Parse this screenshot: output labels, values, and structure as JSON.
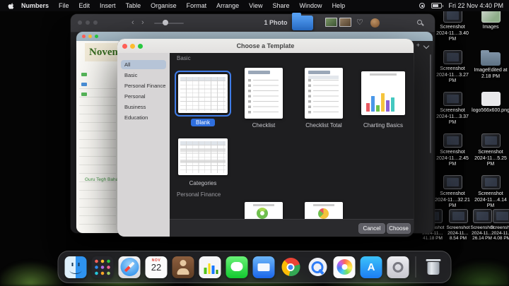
{
  "colors": {
    "accent_blue": "#2f6fde",
    "selection_sidebar": "#b6c4d7"
  },
  "menu_bar": {
    "app_name": "Numbers",
    "menus": [
      "File",
      "Edit",
      "Insert",
      "Table",
      "Organise",
      "Format",
      "Arrange",
      "View",
      "Share",
      "Window",
      "Help"
    ],
    "clock": "Fri 22 Nov 4:40 PM"
  },
  "photos_window": {
    "title": "1 Photo"
  },
  "numbers_window": {
    "doc_heading": "Noven",
    "event_note": "Guru Tegh Baha"
  },
  "template_chooser": {
    "title": "Choose a Template",
    "sidebar_items": [
      "All",
      "Basic",
      "Personal Finance",
      "Personal",
      "Business",
      "Education"
    ],
    "section_basic": "Basic",
    "section_personal_finance": "Personal Finance",
    "template_blank": "Blank",
    "template_checklist": "Checklist",
    "template_checklist_total": "Checklist Total",
    "template_charting_basics": "Charting Basics",
    "template_categories": "Categories",
    "cancel_label": "Cancel",
    "choose_label": "Choose"
  },
  "desktop": {
    "column_a": [
      {
        "label": "Screenshot 2024-11…3.40 PM"
      },
      {
        "label": "Screenshot 2024-11…3.27 PM"
      },
      {
        "label": "Screenshot 2024-11…3.37 PM"
      },
      {
        "label": "Screenshot 2024-11…2.45 PM"
      },
      {
        "label": "Screenshot 2024-11…32.21 PM"
      }
    ],
    "column_b": [
      {
        "label": "Images"
      },
      {
        "label": "ImageEdited at 2.18 PM"
      },
      {
        "label": "logo566x600.png"
      },
      {
        "label": "Screenshot 2024-11…5.25 PM"
      },
      {
        "label": "Screenshot 2024-11…4.14 PM"
      }
    ],
    "bottom_row": [
      {
        "label": "Screenshot 2024-11…41.18 PM"
      },
      {
        "label": "Screenshot 2024-11…8.54 PM"
      },
      {
        "label": "Screenshot 2024-11…26.14 PM"
      },
      {
        "label": "Screenshot 2024-11…4.08 PM"
      }
    ]
  },
  "dock": {
    "calendar": {
      "month": "NOV",
      "day": "22"
    },
    "apps": [
      "finder",
      "launchpad",
      "safari",
      "calendar",
      "contacts",
      "numbers",
      "messages",
      "mail",
      "chrome",
      "quicktime",
      "photos",
      "app-store",
      "system-settings",
      "trash"
    ]
  }
}
